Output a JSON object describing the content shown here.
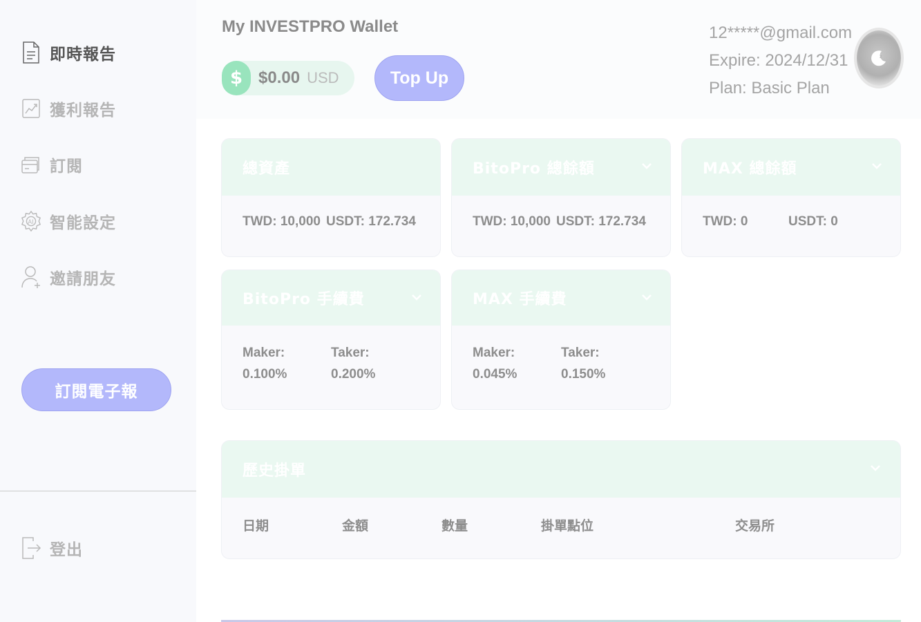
{
  "sidebar": {
    "items": [
      {
        "label": "即時報告",
        "icon": "document-icon",
        "active": true
      },
      {
        "label": "獲利報告",
        "icon": "chart-icon",
        "active": false
      },
      {
        "label": "訂閱",
        "icon": "card-icon",
        "active": false
      },
      {
        "label": "智能設定",
        "icon": "ai-gear-icon",
        "active": false
      },
      {
        "label": "邀請朋友",
        "icon": "user-icon",
        "active": false
      }
    ],
    "subscribe_button": "訂閱電子報",
    "logout_label": "登出"
  },
  "header": {
    "wallet_title": "My INVESTPRO Wallet",
    "coin_symbol": "$",
    "balance": "$0.00",
    "currency": "USD",
    "topup_label": "Top Up",
    "email": "12*****@gmail.com",
    "expire": "Expire: 2024/12/31",
    "plan": "Plan: Basic Plan"
  },
  "cards": {
    "total_assets": {
      "title": "總資產",
      "twd": "TWD: 10,000",
      "usdt": "USDT: 172.734"
    },
    "bitopro_balance": {
      "title": "BitoPro 總餘額",
      "twd": "TWD: 10,000",
      "usdt": "USDT: 172.734"
    },
    "max_balance": {
      "title": "MAX 總餘額",
      "twd": "TWD: 0",
      "usdt": "USDT: 0"
    },
    "bitopro_fee": {
      "title": "BitoPro 手續費",
      "maker_label": "Maker:",
      "maker": "0.100%",
      "taker_label": "Taker:",
      "taker": "0.200%"
    },
    "max_fee": {
      "title": "MAX 手續費",
      "maker_label": "Maker:",
      "maker": "0.045%",
      "taker_label": "Taker:",
      "taker": "0.150%"
    }
  },
  "history": {
    "title": "歷史掛單",
    "columns": [
      "日期",
      "金額",
      "數量",
      "掛單點位",
      "交易所"
    ]
  },
  "colors": {
    "accent": "#b3b8fb",
    "card_header": "#eaf8f1",
    "coin": "#99e4bd"
  }
}
